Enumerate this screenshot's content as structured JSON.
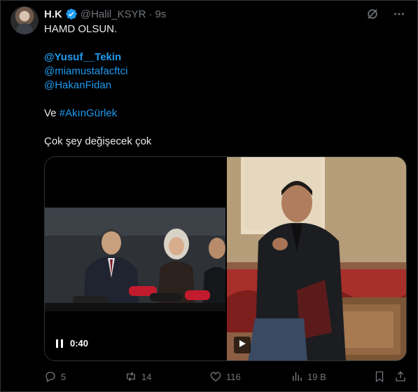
{
  "author": {
    "name": "H.K",
    "handle": "@Halil_KSYR",
    "separator": "·",
    "time": "9s"
  },
  "tweet": {
    "line1": "HAMD OLSUN.",
    "mention1": "@Yusuf__Tekin",
    "mention2": "@miamustafacftci",
    "mention3": "@HakanFidan",
    "ve": "Ve",
    "hashtag": "#AkınGürlek",
    "line_last": "Çok şey değişecek çok"
  },
  "media": {
    "video_time": "0:40",
    "left_icon": "pause-icon",
    "right_icon": "play-icon"
  },
  "actions": {
    "replies": "5",
    "reposts": "14",
    "likes": "116",
    "views": "19 B"
  },
  "colors": {
    "background": "#000000",
    "text": "#e7e9ea",
    "muted": "#71767b",
    "link": "#1d9bf0",
    "verified": "#1d9bf0"
  }
}
